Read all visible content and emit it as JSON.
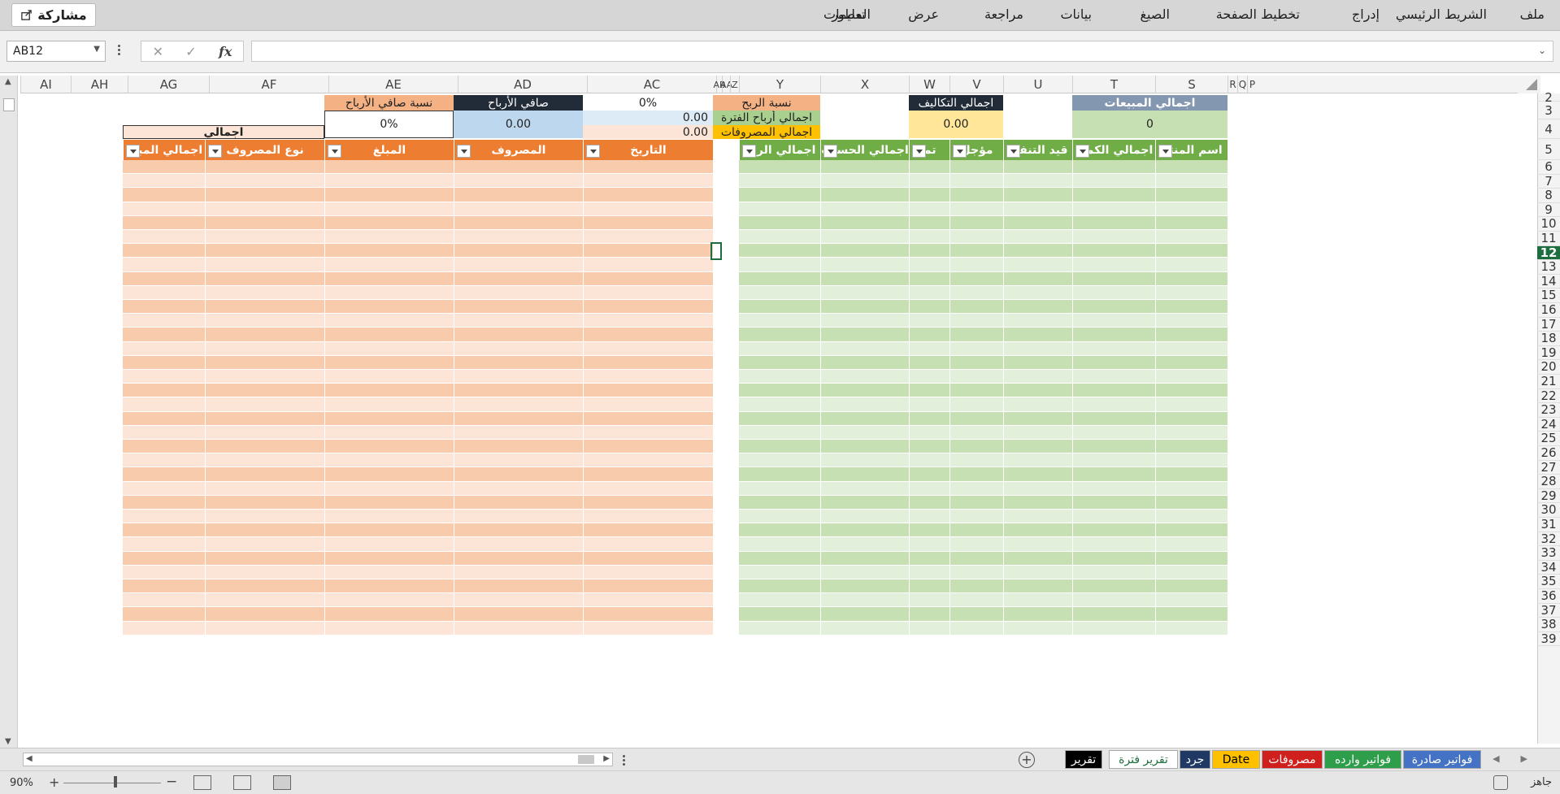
{
  "ribbon": {
    "tabs": [
      "ملف",
      "الشريط الرئيسي",
      "إدراج",
      "تخطيط الصفحة",
      "الصيغ",
      "بيانات",
      "مراجعة",
      "عرض",
      "المطور",
      "تعليمات"
    ],
    "share_label": "مشاركة"
  },
  "formula_bar": {
    "name_box": "AB12",
    "cancel_symbol": "✕",
    "enter_symbol": "✓",
    "fx_symbol": "fx",
    "formula": ""
  },
  "columns": {
    "letters": [
      "AI",
      "AH",
      "AG",
      "AF",
      "AE",
      "AD",
      "AC",
      "AB",
      "AA",
      "Z",
      "Y",
      "X",
      "W",
      "V",
      "U",
      "T",
      "S",
      "R",
      "Q",
      "P"
    ]
  },
  "rows": {
    "numbers": [
      "2",
      "3",
      "4",
      "5",
      "6",
      "7",
      "8",
      "9",
      "10",
      "11",
      "12",
      "13",
      "14",
      "15",
      "16",
      "17",
      "18",
      "19",
      "20",
      "21",
      "22",
      "23",
      "24",
      "25",
      "26",
      "27",
      "28",
      "29",
      "30",
      "31",
      "32",
      "33",
      "34",
      "35",
      "36",
      "37",
      "38",
      "39"
    ],
    "selected": "12"
  },
  "sales_block": {
    "total_sales_label": "اجمالي المبيعات",
    "total_sales_value": "0",
    "total_costs_label": "اجمالي التكاليف",
    "total_costs_value": "0.00",
    "headers": [
      "اسم المنتج",
      "اجمالي الكمية",
      "قيد التنفيذ",
      "مؤجل",
      "تم",
      "اجمالي الحساب",
      "اجمالي الربح"
    ],
    "profit_ratio_label": "نسبة الربح",
    "period_profit_label": "اجمالي أرباح الفترة",
    "total_expenses_label": "اجمالي المصروفات"
  },
  "expenses_block": {
    "profit_ratio_value": "0%",
    "period_profit_value": "0.00",
    "total_expenses_value": "0.00",
    "net_profit_label": "صافي الأرباح",
    "net_profit_value": "0.00",
    "net_profit_ratio_label": "نسبة صافي الأرباح",
    "net_profit_ratio_value": "0%",
    "headers": [
      "التاريخ",
      "المصروف",
      "المبلغ"
    ],
    "summary_title": "اجمالي",
    "summary_headers": [
      "نوع المصروف",
      "اجمالي المبلغ"
    ]
  },
  "sheet_tabs": [
    {
      "label": "فواتير صادرة",
      "bg": "#4472c4",
      "fg": "#ffffff"
    },
    {
      "label": "فواتير وارده",
      "bg": "#2e9e4b",
      "fg": "#ffffff"
    },
    {
      "label": "مصروفات",
      "bg": "#d0201e",
      "fg": "#ffffff"
    },
    {
      "label": "Date",
      "bg": "#ffc000",
      "fg": "#000000"
    },
    {
      "label": "جرد",
      "bg": "#1f3864",
      "fg": "#ffffff"
    },
    {
      "label": "تقرير فترة",
      "bg": "#ffffff",
      "fg": "#1d6e3e"
    },
    {
      "label": "تقرير",
      "bg": "#000000",
      "fg": "#ffffff"
    }
  ],
  "status_bar": {
    "ready": "جاهز",
    "zoom": "90%"
  },
  "colors": {
    "green_header": "#70ad47",
    "green_stripe_a": "#c6e0b4",
    "green_stripe_b": "#e2efda",
    "orange_header": "#ed7d31",
    "orange_stripe_a": "#f8cbad",
    "orange_stripe_b": "#fce4d6",
    "accent": "#1d6e3e"
  }
}
